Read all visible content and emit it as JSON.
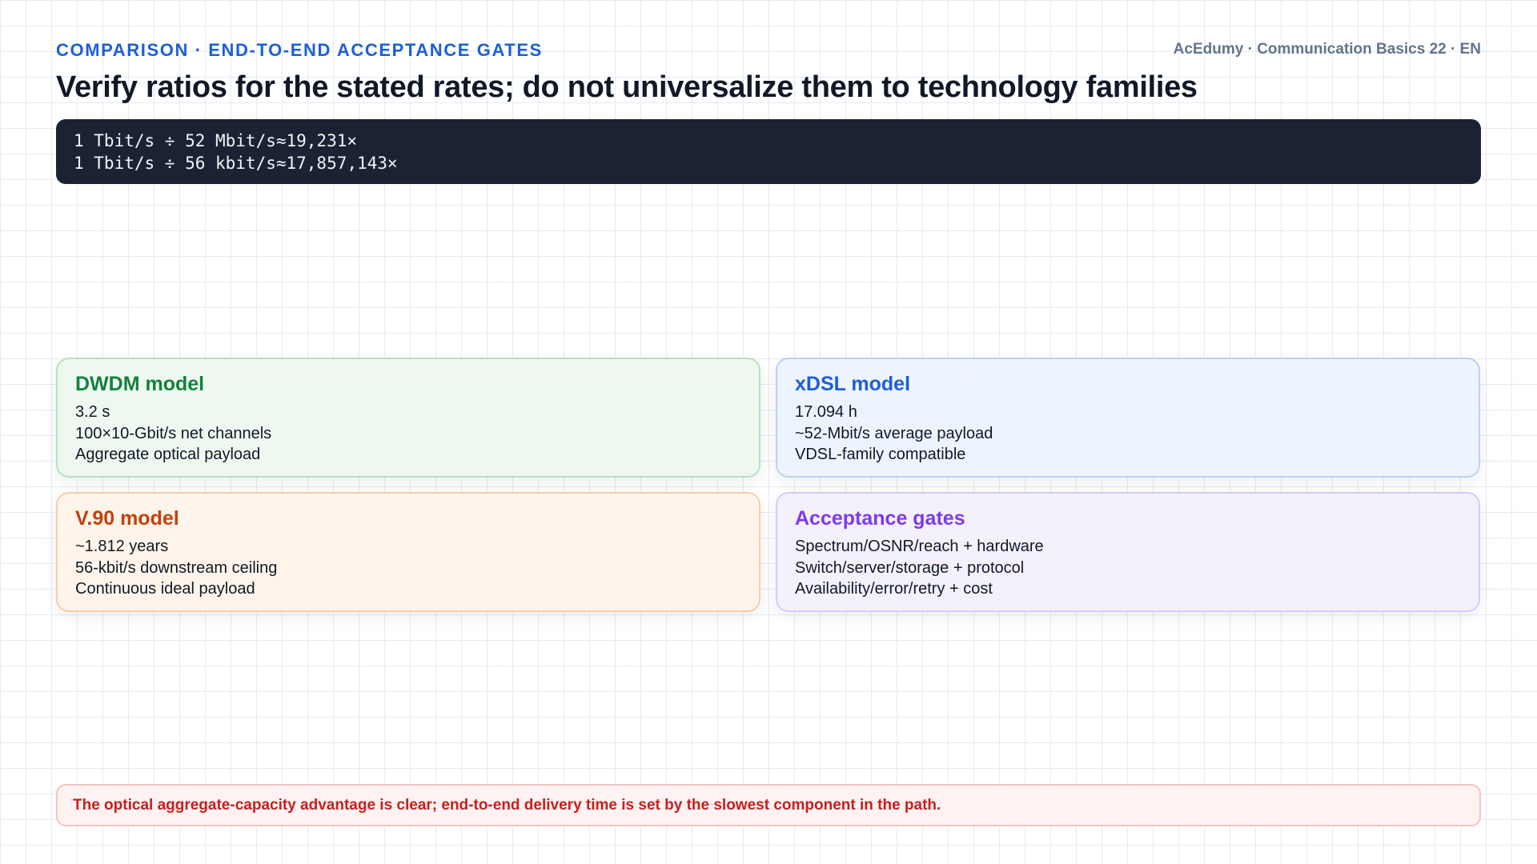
{
  "header": {
    "kicker": "COMPARISON · END-TO-END ACCEPTANCE GATES",
    "brand": "AcEdumy · Communication Basics 22 · EN",
    "title": "Verify ratios for the stated rates; do not universalize them to technology families"
  },
  "formula": {
    "lines": [
      "1 Tbit/s ÷ 52 Mbit/s≈19,231×",
      "1 Tbit/s ÷ 56 kbit/s≈17,857,143×"
    ]
  },
  "cards": [
    {
      "title": "DWDM model",
      "lines": [
        "3.2 s",
        "100×10-Gbit/s net channels",
        "Aggregate optical payload"
      ],
      "accent": "#15803d"
    },
    {
      "title": "xDSL model",
      "lines": [
        "17.094 h",
        "~52-Mbit/s average payload",
        "VDSL-family compatible"
      ],
      "accent": "#1d5fd6"
    },
    {
      "title": "V.90 model",
      "lines": [
        "~1.812 years",
        "56-kbit/s downstream ceiling",
        "Continuous ideal payload"
      ],
      "accent": "#c2410c"
    },
    {
      "title": "Acceptance gates",
      "lines": [
        "Spectrum/OSNR/reach + hardware",
        "Switch/server/storage + protocol",
        "Availability/error/retry + cost"
      ],
      "accent": "#7c3aed"
    }
  ],
  "note": {
    "text": "The optical aggregate-capacity advantage is clear; end-to-end delivery time is set by the slowest component in the path."
  }
}
